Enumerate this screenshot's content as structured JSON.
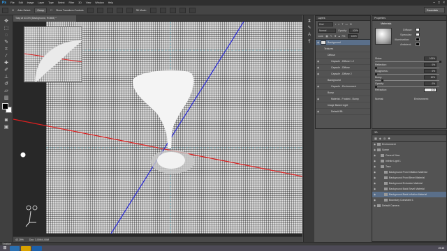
{
  "app": {
    "logo": "Ps"
  },
  "menu": [
    "File",
    "Edit",
    "Image",
    "Layer",
    "Type",
    "Select",
    "Filter",
    "3D",
    "View",
    "Window",
    "Help"
  ],
  "options": {
    "auto_select": "Auto-Select:",
    "auto_select_value": "Group",
    "show_transform": "Show Transform Controls",
    "mode": "3D Mode:",
    "essentials": "Essentials"
  },
  "document": {
    "tab_title": "Tasy at 43.3% (Background, RGB/8) *"
  },
  "status": {
    "zoom": "43.29%",
    "doc": "Doc: 3,00K/4,00M"
  },
  "timeline": {
    "label": "Timeline"
  },
  "layers": {
    "title": "Layers",
    "kind": "Kind",
    "blend": "Normal",
    "opacity_label": "Opacity:",
    "opacity": "100%",
    "lock": "Lock:",
    "fill_label": "Fill:",
    "fill": "100%",
    "items": [
      {
        "label": "Background",
        "indent": 0,
        "selected": true
      },
      {
        "label": "Textures",
        "indent": 1,
        "selected": false
      },
      {
        "label": "Diffuse",
        "indent": 2,
        "selected": false
      },
      {
        "label": "Capsule - Diffuse 1-2",
        "indent": 3,
        "selected": false
      },
      {
        "label": "Capsule - Diffuse",
        "indent": 3,
        "selected": false
      },
      {
        "label": "Capsule - Diffuse 2",
        "indent": 3,
        "selected": false
      },
      {
        "label": "Background",
        "indent": 2,
        "selected": false
      },
      {
        "label": "Capsule - Environment",
        "indent": 3,
        "selected": false
      },
      {
        "label": "Bump",
        "indent": 2,
        "selected": false
      },
      {
        "label": "Material - Frosted - Bump",
        "indent": 3,
        "selected": false
      },
      {
        "label": "Image Based Light",
        "indent": 2,
        "selected": false
      },
      {
        "label": "Default IBL",
        "indent": 3,
        "selected": false
      }
    ]
  },
  "properties": {
    "title": "Properties",
    "section": "Materials",
    "labels": {
      "diffuse": "Diffuse:",
      "specular": "Specular:",
      "illumination": "Illumination:",
      "ambient": "Ambient:",
      "shine": "Shine:",
      "reflection": "Reflection:",
      "roughness": "Roughness:",
      "bump": "Bump:",
      "opacity": "Opacity:",
      "refraction": "Refraction:",
      "normal": "Normal:",
      "environment": "Environment:"
    },
    "values": {
      "shine": "100%",
      "reflection": "0%",
      "roughness": "0%",
      "bump": "10%",
      "opacity": "0%",
      "refraction": "1.00"
    },
    "levels": {
      "shine": 1.0,
      "reflection": 0.0,
      "roughness": 0.0,
      "bump": 0.1,
      "opacity": 0.0
    }
  },
  "scene": {
    "title": "3D",
    "items": [
      {
        "label": "Environment",
        "indent": 0,
        "selected": false
      },
      {
        "label": "Scene",
        "indent": 0,
        "selected": false
      },
      {
        "label": "Current View",
        "indent": 1,
        "selected": false
      },
      {
        "label": "Infinite Light 1",
        "indent": 1,
        "selected": false
      },
      {
        "label": "Taza",
        "indent": 1,
        "selected": false
      },
      {
        "label": "Background Front Inflation Material",
        "indent": 2,
        "selected": false
      },
      {
        "label": "Background Front Bevel Material",
        "indent": 2,
        "selected": false
      },
      {
        "label": "Background Extrusion Material",
        "indent": 2,
        "selected": false
      },
      {
        "label": "Background Back Bevel Material",
        "indent": 2,
        "selected": false
      },
      {
        "label": "Background Back Inflation Material",
        "indent": 2,
        "selected": true
      },
      {
        "label": "Boundary Constraint 1",
        "indent": 2,
        "selected": false
      },
      {
        "label": "Default Camera",
        "indent": 0,
        "selected": false
      }
    ]
  },
  "taskbar": {
    "clock": "19:45"
  },
  "colors": {
    "accent": "#31a8ff",
    "selection": "#5a6f8a",
    "axis_x": "#e02020",
    "axis_y": "#2a2ad8"
  }
}
